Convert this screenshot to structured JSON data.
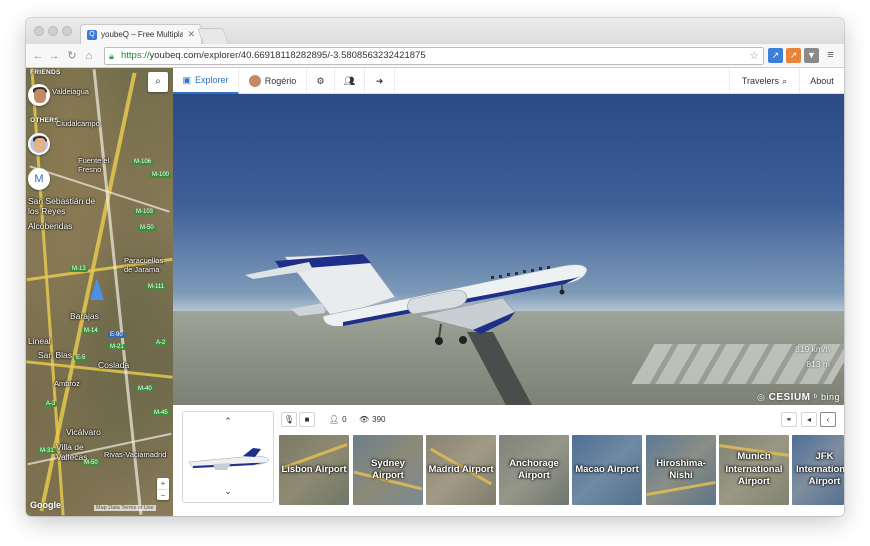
{
  "browser": {
    "tab_title": "youbeQ – Free Multiplayer",
    "tab_favicon": "youbeq-favicon",
    "url_scheme": "https://",
    "url_rest": "youbeq.com/explorer/40.66918118282895/-3.5808563232421875"
  },
  "sidebar": {
    "friends_label": "FRIENDS",
    "others_label": "OTHERS",
    "other_avatar_letter": "M",
    "map_labels": [
      "Valdeiagua",
      "Ciudalcampo",
      "Fuente el Fresno",
      "San Sebastián de los Reyes",
      "Alcobendas",
      "Paracuellos de Jarama",
      "Barajas",
      "Lineal",
      "San Blas",
      "Coslada",
      "Ambroz",
      "Vicálvaro",
      "Villa de Vallecas",
      "Rivas-Vaciamadrid"
    ],
    "road_shields": [
      "M-106",
      "M-100",
      "M-103",
      "M-50",
      "M-13",
      "M-111",
      "M-14",
      "E-90",
      "M-21",
      "A-2",
      "M-40",
      "E-5",
      "M-45",
      "A-3",
      "M-31",
      "M-50"
    ],
    "attribution": "Google",
    "map_data": "Map Data   Terms of Use"
  },
  "nav": {
    "explorer_label": "Explorer",
    "user_label": "Rogério",
    "travelers_label": "Travelers",
    "about_label": "About"
  },
  "viewport": {
    "speed": "819 km/h",
    "altitude": "813 m",
    "engine_brand": "CESIUM",
    "imagery_brand": "bing"
  },
  "controls": {
    "viewers_count": "0",
    "views_count": "390"
  },
  "airports": [
    {
      "name": "Lisbon Airport"
    },
    {
      "name": "Sydney Airport"
    },
    {
      "name": "Madrid Airport"
    },
    {
      "name": "Anchorage Airport"
    },
    {
      "name": "Macao Airport"
    },
    {
      "name": "Hiroshima-Nishi"
    },
    {
      "name": "Munich International Airport"
    },
    {
      "name": "JFK International Airport"
    }
  ],
  "colors": {
    "accent": "#2e6fc9",
    "sky_top": "#2b4a86",
    "https_green": "#1d8a2c"
  }
}
